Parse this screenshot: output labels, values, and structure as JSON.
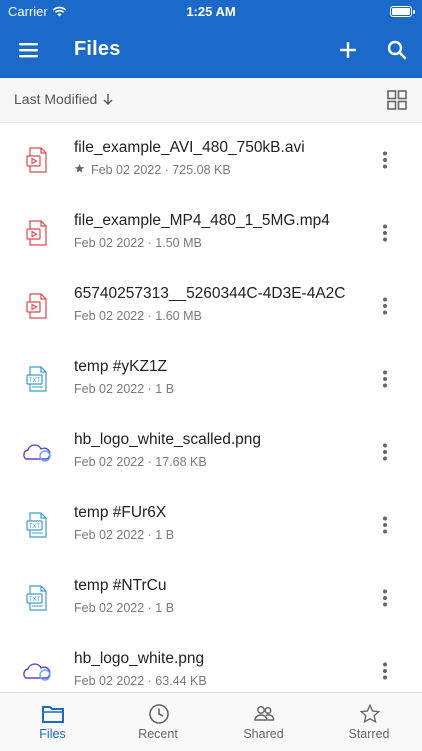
{
  "status": {
    "carrier": "Carrier",
    "time": "1:25 AM"
  },
  "header": {
    "title": "Files",
    "menu_icon": "menu-icon",
    "add_icon": "plus-icon",
    "search_icon": "search-icon"
  },
  "sort": {
    "label": "Last Modified",
    "direction_icon": "arrow-down-icon",
    "view_icon": "grid-view-icon"
  },
  "colors": {
    "brand": "#1b6ac9",
    "video_icon": "#e0474a",
    "text_icon": "#3c9bd8",
    "cloud_icon": "#6a3fd0",
    "active_tab": "#1b6ac9"
  },
  "files": [
    {
      "name": "file_example_AVI_480_750kB.avi",
      "meta": "Feb 02 2022 · 725.08 KB",
      "starred": true,
      "icon": "video-file-icon"
    },
    {
      "name": "file_example_MP4_480_1_5MG.mp4",
      "meta": "Feb 02 2022 · 1.50 MB",
      "starred": false,
      "icon": "video-file-icon"
    },
    {
      "name": "65740257313__5260344C-4D3E-4A2C",
      "meta": "Feb 02 2022 · 1.60 MB",
      "starred": false,
      "icon": "video-file-icon"
    },
    {
      "name": "temp #yKZ1Z",
      "meta": "Feb 02 2022 · 1 B",
      "starred": false,
      "icon": "txt-file-icon"
    },
    {
      "name": "hb_logo_white_scalled.png",
      "meta": "Feb 02 2022 · 17.68 KB",
      "starred": false,
      "icon": "cloud-image-icon"
    },
    {
      "name": "temp #FUr6X",
      "meta": "Feb 02 2022 · 1 B",
      "starred": false,
      "icon": "txt-file-icon"
    },
    {
      "name": "temp #NTrCu",
      "meta": "Feb 02 2022 · 1 B",
      "starred": false,
      "icon": "txt-file-icon"
    },
    {
      "name": "hb_logo_white.png",
      "meta": "Feb 02 2022 · 63.44 KB",
      "starred": false,
      "icon": "cloud-image-icon"
    }
  ],
  "tabs": [
    {
      "label": "Files",
      "icon": "folder-icon",
      "active": true
    },
    {
      "label": "Recent",
      "icon": "clock-icon",
      "active": false
    },
    {
      "label": "Shared",
      "icon": "people-icon",
      "active": false
    },
    {
      "label": "Starred",
      "icon": "star-icon",
      "active": false
    }
  ]
}
